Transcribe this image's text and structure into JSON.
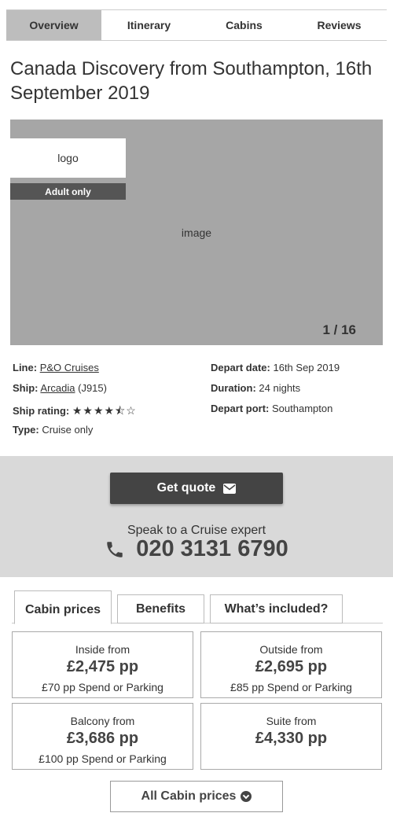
{
  "top_tabs": [
    {
      "label": "Overview"
    },
    {
      "label": "Itinerary"
    },
    {
      "label": "Cabins"
    },
    {
      "label": "Reviews"
    }
  ],
  "page_title": "Canada Discovery from Southampton, 16th September 2019",
  "hero": {
    "logo_text": "logo",
    "badge": "Adult only",
    "image_text": "image",
    "counter": "1 / 16"
  },
  "details": {
    "line_label": "Line:",
    "line_value": "P&O Cruises",
    "ship_label": "Ship:",
    "ship_value": "Arcadia",
    "ship_code": "(J915)",
    "rating_label": "Ship rating:",
    "rating_value": 3.5,
    "rating_stars": "★★★★⯪☆",
    "type_label": "Type:",
    "type_value": "Cruise only",
    "depart_date_label": "Depart date:",
    "depart_date_value": "16th Sep 2019",
    "duration_label": "Duration:",
    "duration_value": "24 nights",
    "depart_port_label": "Depart port:",
    "depart_port_value": "Southampton"
  },
  "quote": {
    "button_label": "Get quote",
    "speak_text": "Speak to a Cruise expert",
    "phone": "020 3131 6790"
  },
  "price_tabs": [
    {
      "label": "Cabin prices"
    },
    {
      "label": "Benefits"
    },
    {
      "label": "What’s included?"
    }
  ],
  "cabins": [
    {
      "label": "Inside from",
      "price": "£2,475 pp",
      "note": "£70 pp Spend or Parking"
    },
    {
      "label": "Outside from",
      "price": "£2,695 pp",
      "note": "£85 pp Spend or Parking"
    },
    {
      "label": "Balcony from",
      "price": "£3,686 pp",
      "note": "£100 pp Spend or Parking"
    },
    {
      "label": "Suite from",
      "price": "£4,330 pp",
      "note": ""
    }
  ],
  "all_cabins_label": "All Cabin prices"
}
